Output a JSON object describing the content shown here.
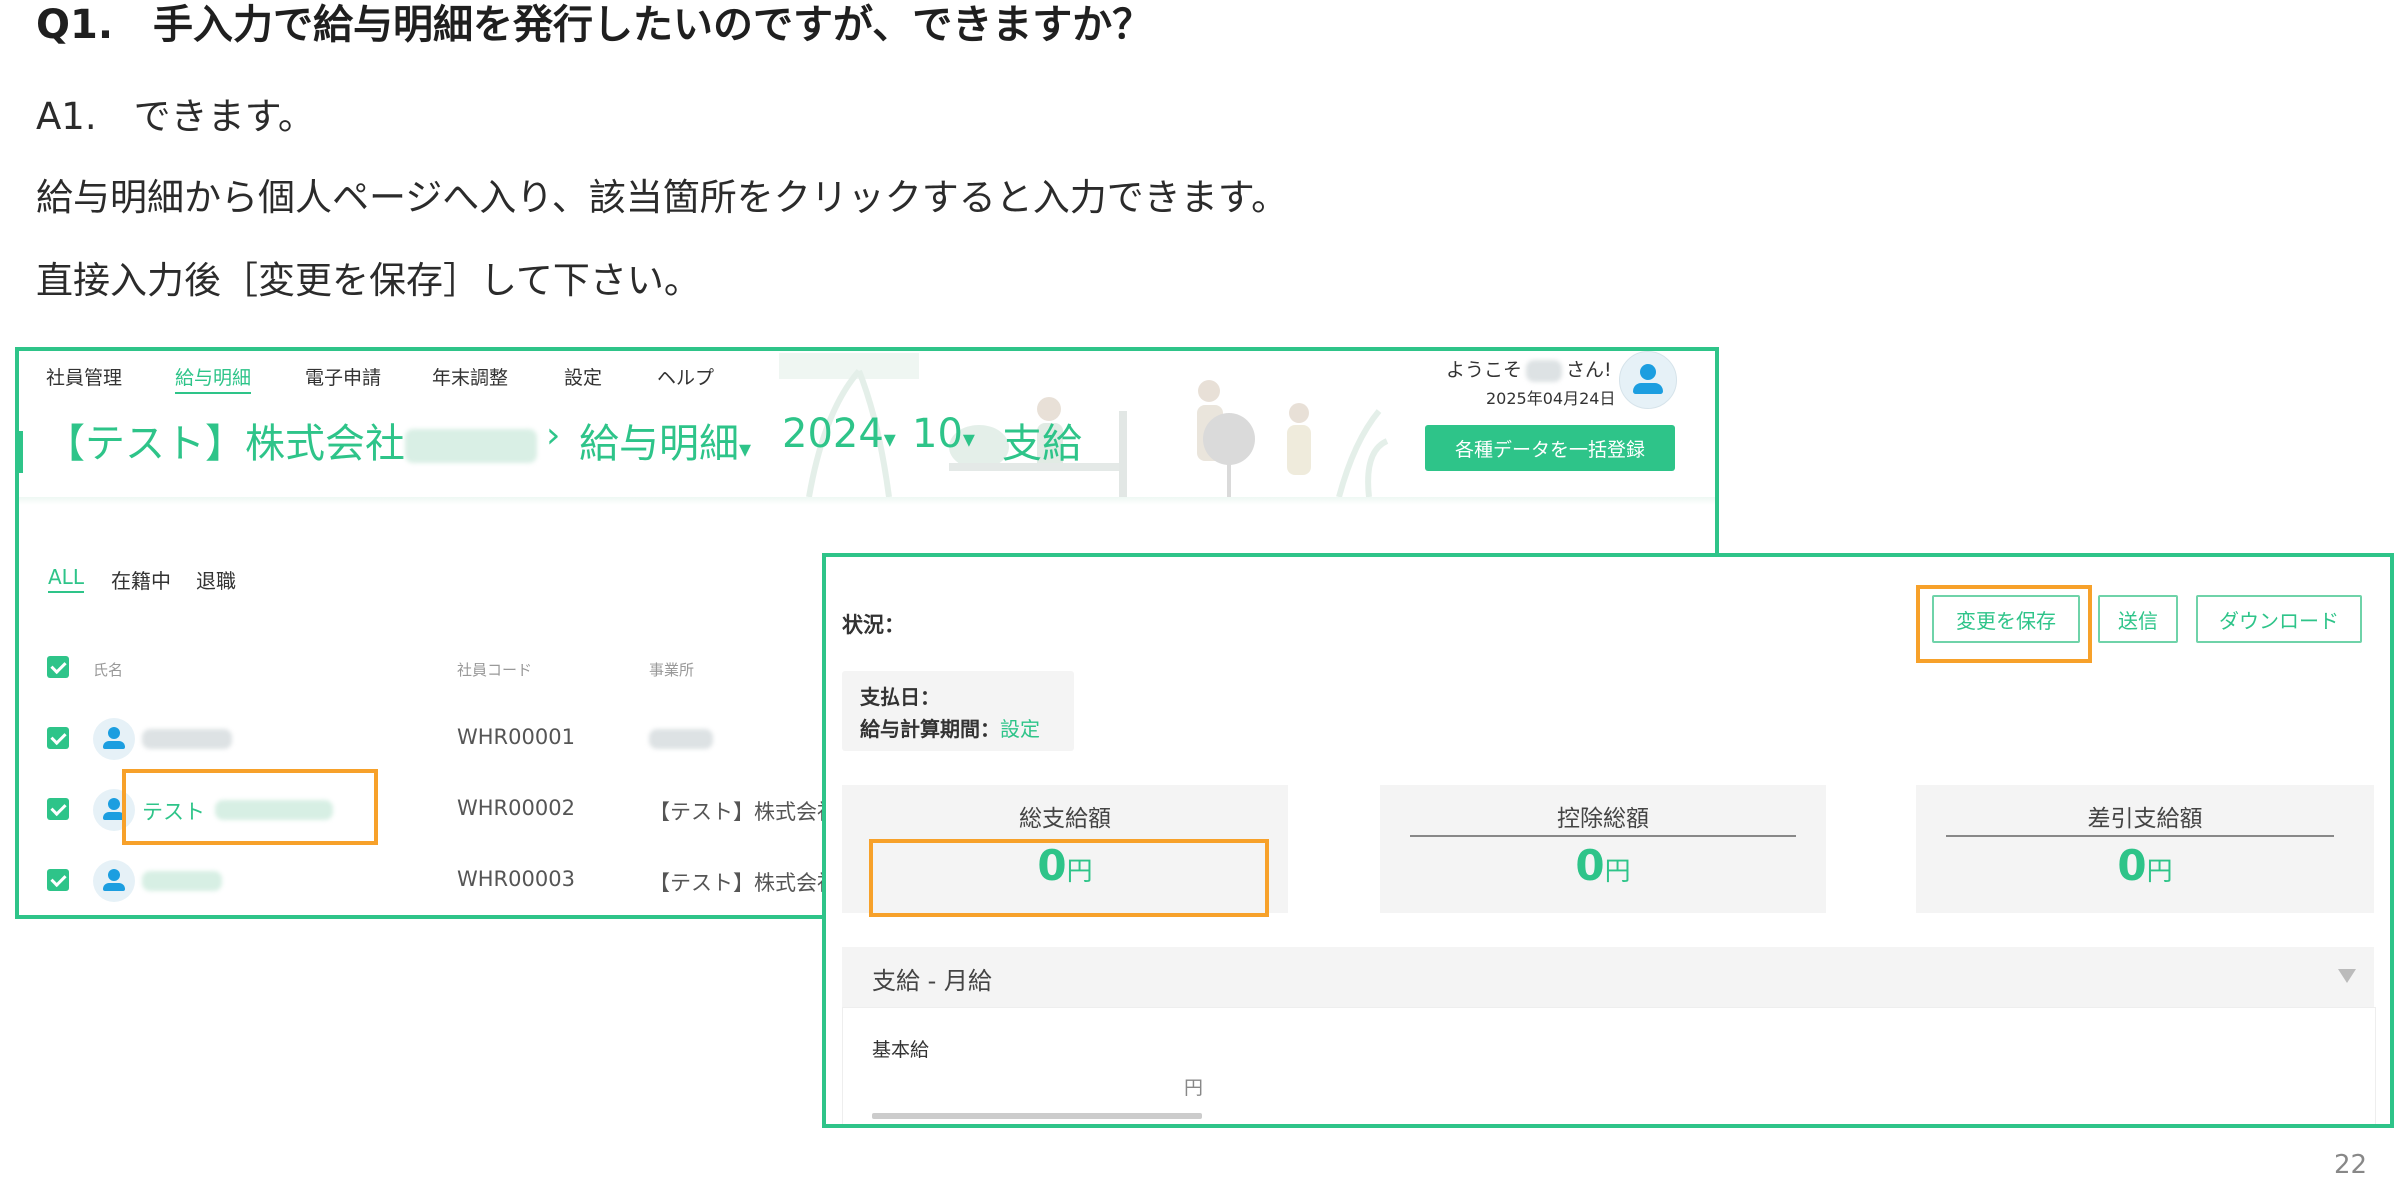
{
  "heading": "Q1.　手入力で給与明細を発行したいのですが、できますか？",
  "answer": "A1.　できます。",
  "line1": "給与明細から個人ページへ入り、該当箇所をクリックすると入力できます。",
  "line2": "直接入力後［変更を保存］して下さい。",
  "page_number": "22",
  "colors": {
    "accent": "#2ec489",
    "highlight": "#f7a12a",
    "avatar": "#1c9ee0"
  },
  "app": {
    "nav": [
      "社員管理",
      "給与明細",
      "電子申請",
      "年末調整",
      "設定",
      "ヘルプ"
    ],
    "welcome_prefix": "ようこそ",
    "welcome_suffix": "さん!",
    "date": "2025年04月24日",
    "breadcrumb": {
      "company": "【テスト】株式会社",
      "section": "給与明細",
      "year": "2024",
      "month": "10",
      "type": "支給",
      "separator": "›",
      "caret": "▾"
    },
    "bulk_button": "各種データを一括登録",
    "filters": [
      "ALL",
      "在籍中",
      "退職"
    ],
    "columns": {
      "name": "氏名",
      "code": "社員コード",
      "office": "事業所"
    },
    "rows": [
      {
        "name": "",
        "code": "WHR00001",
        "office": ""
      },
      {
        "name": "テスト",
        "code": "WHR00002",
        "office": "【テスト】株式会社"
      },
      {
        "name": "",
        "code": "WHR00003",
        "office": "【テスト】株式会社"
      }
    ]
  },
  "detail": {
    "status_label": "状況：",
    "buttons": {
      "save": "変更を保存",
      "send": "送信",
      "download": "ダウンロード"
    },
    "pay_date_label": "支払日：",
    "period_label": "給与計算期間：",
    "period_link": "設定",
    "totals": [
      {
        "label": "総支給額",
        "value": "0",
        "unit": "円"
      },
      {
        "label": "控除総額",
        "value": "0",
        "unit": "円"
      },
      {
        "label": "差引支給額",
        "value": "0",
        "unit": "円"
      }
    ],
    "section_title": "支給 - 月給",
    "basic_pay_label": "基本給",
    "basic_pay_unit": "円"
  }
}
